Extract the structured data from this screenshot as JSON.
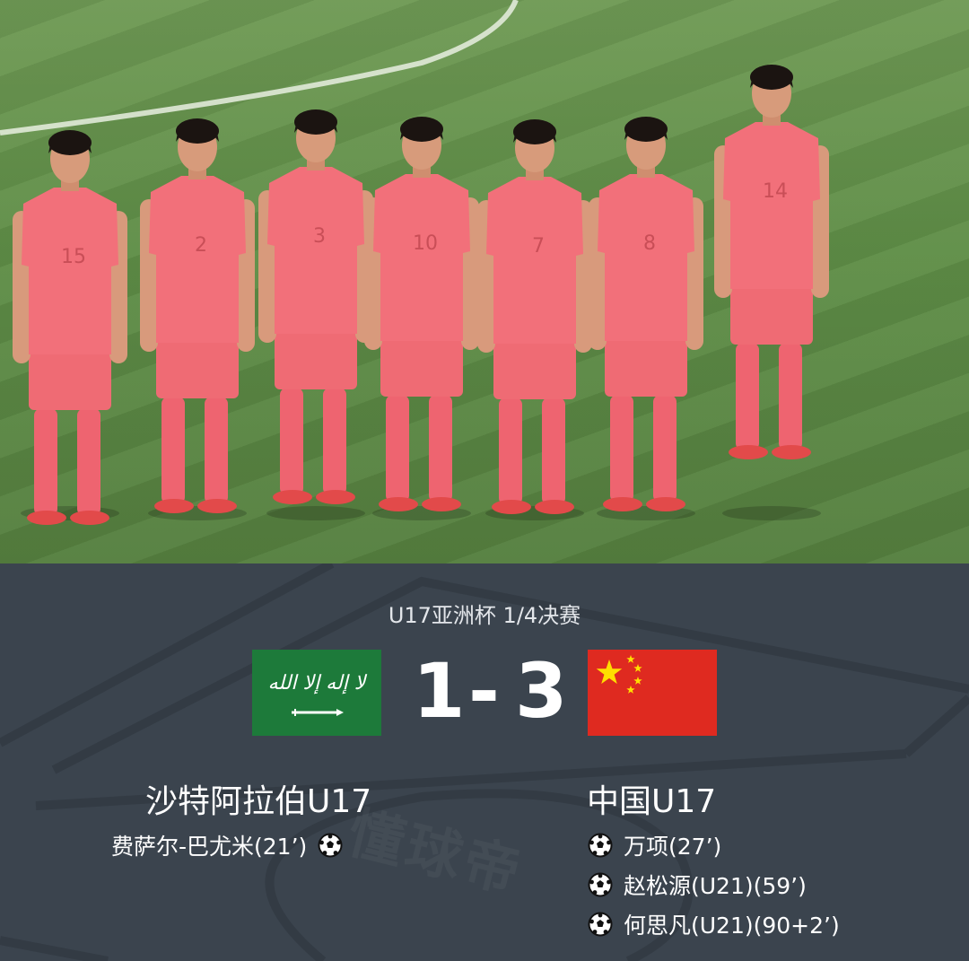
{
  "competition": "U17亚洲杯 1/4决赛",
  "home": {
    "name": "沙特阿拉伯U17",
    "score": "1",
    "flag_icon": "saudi-arabia-flag-icon",
    "flag_color": "#1d7a3a",
    "scorers": [
      {
        "text": "费萨尔-巴尤米(21’)"
      }
    ]
  },
  "away": {
    "name": "中国U17",
    "score": "3",
    "flag_icon": "china-flag-icon",
    "flag_color": "#df2a20",
    "scorers": [
      {
        "text": "万项(27’)"
      },
      {
        "text": "赵松源(U21)(59’)"
      },
      {
        "text": "何思凡(U21)(90+2’)"
      }
    ]
  },
  "separator": "-",
  "jersey_numbers": [
    "15",
    "2",
    "3",
    "10",
    "7",
    "8",
    "14"
  ],
  "colors": {
    "panel_bg": "#3b444e",
    "jersey": "#f2707a",
    "pitch": "#5f8e47"
  }
}
